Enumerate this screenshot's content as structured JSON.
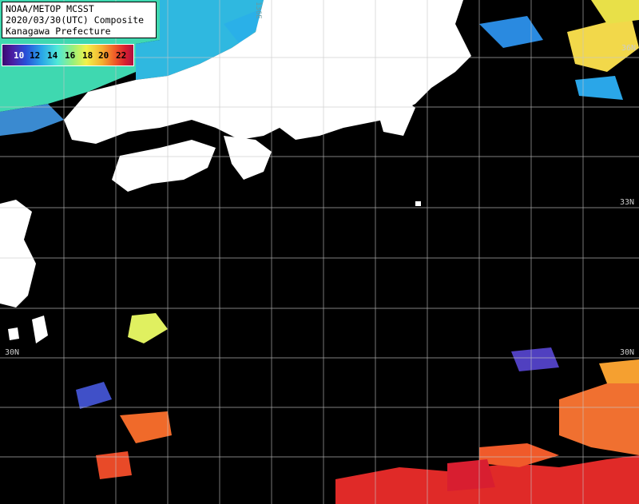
{
  "title": {
    "line1": "NOAA/METOP MCSST",
    "line2": "2020/03/30(UTC) Composite",
    "line3": "Kanagawa Prefecture"
  },
  "scale": {
    "labels": [
      "10",
      "12",
      "14",
      "16",
      "18",
      "20",
      "22"
    ]
  },
  "latitude_labels": {
    "n36": "36N",
    "n33_right": "33N",
    "n30_left": "30N",
    "n30_right": "30N"
  },
  "lon_label": "136E",
  "colors": {
    "background": "#000000",
    "land": "#ffffff",
    "grid": "#c8c8c8"
  }
}
